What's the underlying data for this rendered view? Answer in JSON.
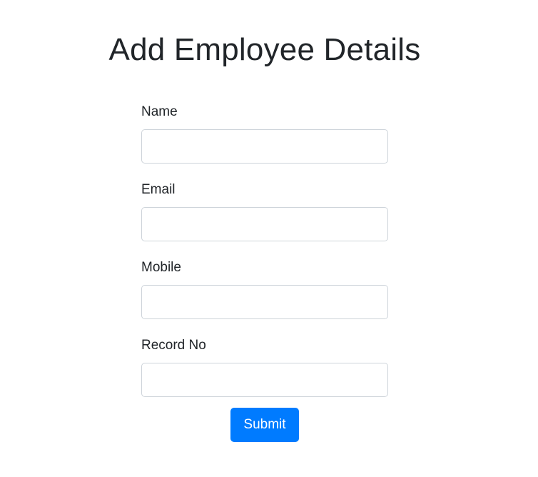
{
  "page": {
    "title": "Add Employee Details"
  },
  "form": {
    "fields": [
      {
        "label": "Name",
        "value": "",
        "placeholder": ""
      },
      {
        "label": "Email",
        "value": "",
        "placeholder": ""
      },
      {
        "label": "Mobile",
        "value": "",
        "placeholder": ""
      },
      {
        "label": "Record No",
        "value": "",
        "placeholder": ""
      }
    ],
    "submit_label": "Submit"
  },
  "colors": {
    "primary": "#007bff",
    "text": "#212529",
    "input_border": "#ced4da",
    "background": "#ffffff"
  }
}
